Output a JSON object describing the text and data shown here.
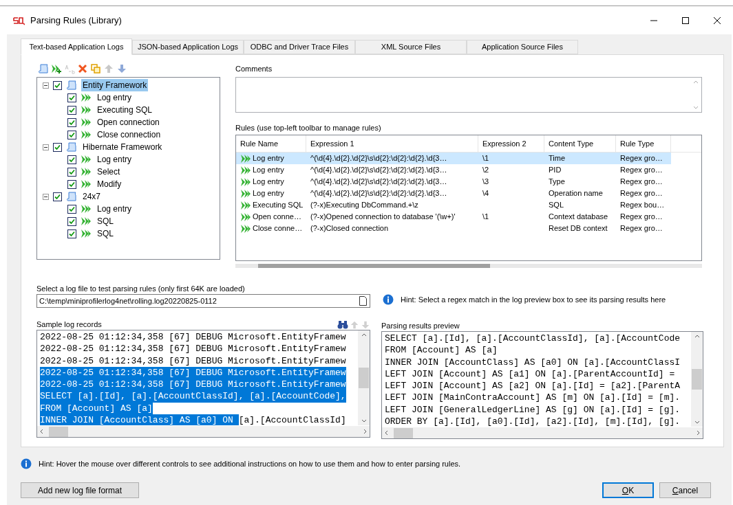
{
  "window": {
    "title": "Parsing Rules (Library)"
  },
  "tabs": [
    {
      "label": "Text-based Application Logs",
      "selected": true
    },
    {
      "label": "JSON-based Application Logs",
      "selected": false
    },
    {
      "label": "ODBC and Driver Trace Files",
      "selected": false
    },
    {
      "label": "XML Source Files",
      "selected": false
    },
    {
      "label": "Application Source Files",
      "selected": false
    }
  ],
  "toolbar": [
    {
      "kind": "add-group",
      "disabled": false
    },
    {
      "kind": "add-rule",
      "disabled": false
    },
    {
      "kind": "rename",
      "disabled": true
    },
    {
      "kind": "delete",
      "disabled": false
    },
    {
      "kind": "copy",
      "disabled": false
    },
    {
      "kind": "up",
      "disabled": true
    },
    {
      "kind": "down",
      "disabled": false
    }
  ],
  "tree": [
    {
      "label": "Entity Framework",
      "checked": true,
      "expanded": true,
      "selected": true,
      "children": [
        {
          "label": "Log entry",
          "checked": true,
          "selected": false
        },
        {
          "label": "Executing SQL",
          "checked": true,
          "selected": false
        },
        {
          "label": "Open connection",
          "checked": true,
          "selected": false
        },
        {
          "label": "Close connection",
          "checked": true,
          "selected": false
        }
      ]
    },
    {
      "label": "Hibernate Framework",
      "checked": true,
      "expanded": true,
      "selected": false,
      "children": [
        {
          "label": "Log entry",
          "checked": true,
          "selected": false
        },
        {
          "label": "Select",
          "checked": true,
          "selected": false
        },
        {
          "label": "Modify",
          "checked": true,
          "selected": false
        }
      ]
    },
    {
      "label": "24x7",
      "checked": true,
      "expanded": true,
      "selected": false,
      "children": [
        {
          "label": "Log entry",
          "checked": true,
          "selected": false
        },
        {
          "label": "SQL",
          "checked": true,
          "selected": false
        },
        {
          "label": "SQL",
          "checked": true,
          "selected": false
        }
      ]
    }
  ],
  "comments": {
    "label": "Comments"
  },
  "rules": {
    "label": "Rules (use top-left toolbar to manage rules)",
    "columns": [
      "Rule Name",
      "Expression 1",
      "Expression 2",
      "Content Type",
      "Rule Type"
    ],
    "rows": [
      {
        "selected": true,
        "cells": [
          "Log entry",
          "^(\\d{4}.\\d{2}.\\d{2}\\s\\d{2}:\\d{2}:\\d{2}.\\d{3…",
          "\\1",
          "Time",
          "Regex gro…"
        ]
      },
      {
        "selected": false,
        "cells": [
          "Log entry",
          "^(\\d{4}.\\d{2}.\\d{2}\\s\\d{2}:\\d{2}:\\d{2}.\\d{3…",
          "\\2",
          "PID",
          "Regex gro…"
        ]
      },
      {
        "selected": false,
        "cells": [
          "Log entry",
          "^(\\d{4}.\\d{2}.\\d{2}\\s\\d{2}:\\d{2}:\\d{2}.\\d{3…",
          "\\3",
          "Type",
          "Regex gro…"
        ]
      },
      {
        "selected": false,
        "cells": [
          "Log entry",
          "^(\\d{4}.\\d{2}.\\d{2}\\s\\d{2}:\\d{2}:\\d{2}.\\d{3…",
          "\\4",
          "Operation name",
          "Regex gro…"
        ]
      },
      {
        "selected": false,
        "cells": [
          "Executing SQL",
          "(?-x)Executing DbCommand.+\\z",
          "",
          "SQL",
          "Regex bou…"
        ]
      },
      {
        "selected": false,
        "cells": [
          "Open conne…",
          "(?-x)Opened connection to database '(\\w+)'",
          "\\1",
          "Context database",
          "Regex gro…"
        ]
      },
      {
        "selected": false,
        "cells": [
          "Close conne…",
          "(?-x)Closed connection",
          "",
          "Reset DB context",
          "Regex gro…"
        ]
      }
    ]
  },
  "log_file": {
    "label": "Select a log file to test parsing rules (only first 64K are loaded)",
    "value": "C:\\temp\\miniprofilerlog4net\\rolling.log20220825-0112"
  },
  "hint_right": "Hint: Select a regex match in the log preview box to see its parsing results here",
  "sample_log": {
    "label": "Sample log records",
    "lines": [
      [
        {
          "text": "2022-08-25 01:12:34,358 [67] DEBUG Microsoft.EntityFramew",
          "selected": false
        }
      ],
      [
        {
          "text": "2022-08-25 01:12:34,358 [67] DEBUG Microsoft.EntityFramew",
          "selected": false
        }
      ],
      [
        {
          "text": "2022-08-25 01:12:34,358 [67] DEBUG Microsoft.EntityFramew",
          "selected": false
        }
      ],
      [
        {
          "text": "2022-08-25 01:12:34,358 [67] DEBUG Microsoft.EntityFramew",
          "selected": true
        }
      ],
      [
        {
          "text": "2022-08-25 01:12:34,358 [67] DEBUG Microsoft.EntityFramew",
          "selected": true
        }
      ],
      [
        {
          "text": "SELECT [a].[Id], [a].[AccountClassId], [a].[AccountCode],",
          "selected": true
        }
      ],
      [
        {
          "text": "FROM [Account] AS [a]",
          "selected": true
        }
      ],
      [
        {
          "text": "INNER JOIN [AccountClass] AS [a0] ON ",
          "selected": true
        },
        {
          "text": "[a].[AccountClassId]",
          "selected": false
        }
      ]
    ]
  },
  "preview": {
    "label": "Parsing results preview",
    "lines": [
      "SELECT [a].[Id], [a].[AccountClassId], [a].[AccountCode",
      "FROM [Account] AS [a]",
      "INNER JOIN [AccountClass] AS [a0] ON [a].[AccountClassI",
      "LEFT JOIN [Account] AS [a1] ON [a].[ParentAccountId] =",
      "LEFT JOIN [Account] AS [a2] ON [a].[Id] = [a2].[ParentA",
      "LEFT JOIN [MainContraAccount] AS [m] ON [a].[Id] = [m].",
      "LEFT JOIN [GeneralLedgerLine] AS [g] ON [a].[Id] = [g].",
      "ORDER BY [a].[Id], [a0].[Id], [a2].[Id], [m].[Id], [g]."
    ]
  },
  "hint_bottom": "Hint: Hover the mouse over different controls to see additional instructions on how to use them and how to enter parsing rules.",
  "buttons": [
    {
      "label": "Add new log file format",
      "default": false,
      "mnemonic": false
    },
    {
      "label": "OK",
      "default": true,
      "mnemonic": true
    },
    {
      "label": "Cancel",
      "default": false,
      "mnemonic": true
    }
  ]
}
